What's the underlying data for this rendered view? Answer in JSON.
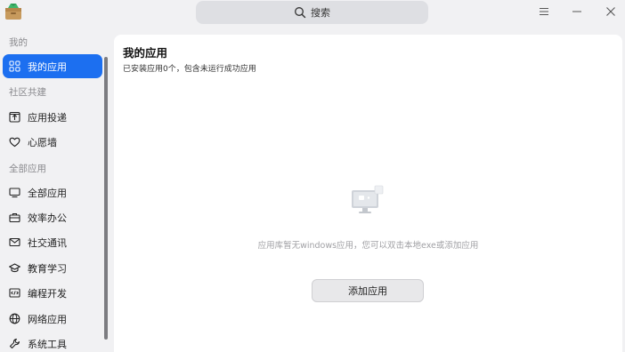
{
  "titlebar": {
    "search_placeholder": "搜索",
    "icons": {
      "logo": "app-store-box-icon",
      "menu": "hamburger-menu-icon",
      "minimize": "minimize-icon",
      "close": "close-icon"
    }
  },
  "sidebar": {
    "section_mine": "我的",
    "my_apps": "我的应用",
    "section_community": "社区共建",
    "app_submit": "应用投递",
    "wish_wall": "心愿墙",
    "section_all": "全部应用",
    "all_apps": "全部应用",
    "office": "效率办公",
    "social": "社交通讯",
    "education": "教育学习",
    "dev": "编程开发",
    "network": "网络应用",
    "tools": "系统工具",
    "active_color": "#1c6ff0"
  },
  "main": {
    "title": "我的应用",
    "subtitle": "已安装应用0个，包含未运行成功应用",
    "empty_message": "应用库暂无windows应用，您可以双击本地exe或添加应用",
    "add_button": "添加应用"
  }
}
